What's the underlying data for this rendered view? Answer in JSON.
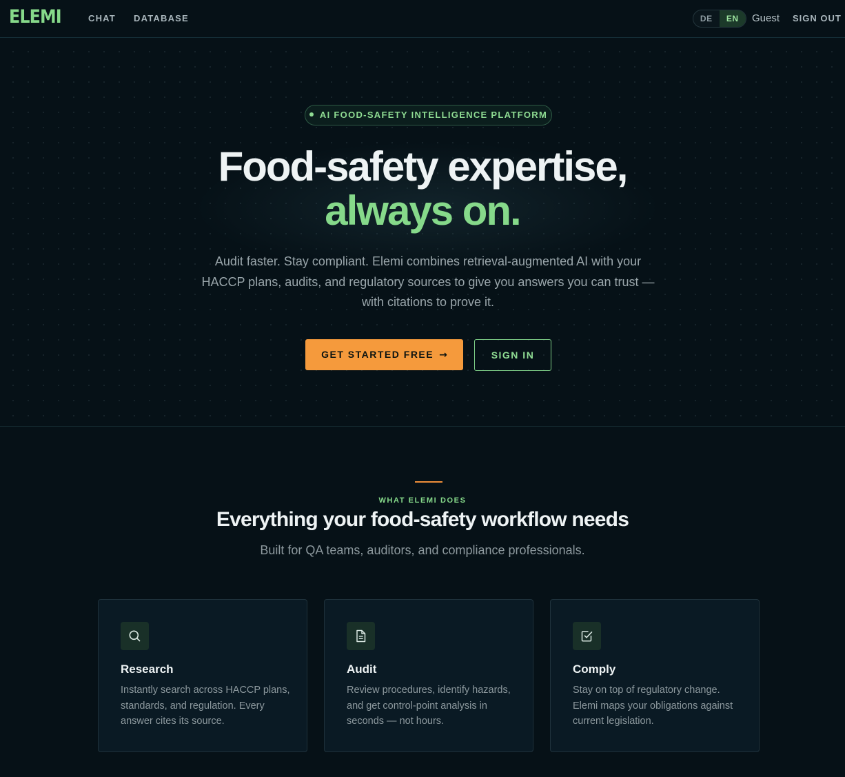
{
  "nav": {
    "logo": "ELEMI",
    "links": [
      {
        "label": "CHAT"
      },
      {
        "label": "DATABASE"
      }
    ],
    "language": {
      "options": [
        "DE",
        "EN"
      ],
      "selected": "EN"
    },
    "user": "Guest",
    "sign_out": "SIGN OUT"
  },
  "hero": {
    "badge": "AI FOOD-SAFETY INTELLIGENCE PLATFORM",
    "title_line1": "Food-safety expertise,",
    "title_line2": "always on.",
    "subtitle": "Audit faster. Stay compliant. Elemi combines retrieval-augmented AI with your HACCP plans, audits, and regulatory sources to give you answers you can trust — with citations to prove it.",
    "primary_button": "GET STARTED FREE",
    "primary_button_arrow": "→",
    "secondary_button": "SIGN IN"
  },
  "features": {
    "eyebrow": "WHAT ELEMI DOES",
    "title": "Everything your food-safety workflow needs",
    "subtitle": "Built for QA teams, auditors, and compliance professionals.",
    "cards": [
      {
        "icon": "search-icon",
        "title": "Research",
        "text": "Instantly search across HACCP plans, standards, and regulation. Every answer cites its source."
      },
      {
        "icon": "document-icon",
        "title": "Audit",
        "text": "Review procedures, identify hazards, and get control-point analysis in seconds — not hours."
      },
      {
        "icon": "checkbox-icon",
        "title": "Comply",
        "text": "Stay on top of regulatory change. Elemi maps your obligations against current legislation."
      }
    ]
  },
  "colors": {
    "background": "#061117",
    "accent_green": "#86d98a",
    "accent_orange": "#f59a3c",
    "card_background": "#0a1a24"
  }
}
